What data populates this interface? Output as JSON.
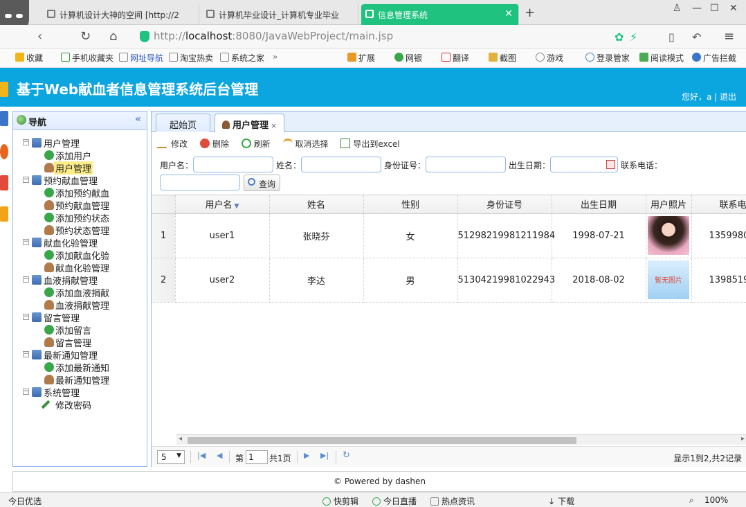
{
  "browser": {
    "tabs": [
      {
        "label": "计算机设计大神的空间 [http://2",
        "active": false
      },
      {
        "label": "计算机毕业设计_计算机专业毕业",
        "active": false
      },
      {
        "label": "信息管理系统",
        "active": true
      }
    ],
    "url_prefix": "http://",
    "url_host": "localhost",
    "url_rest": ":8080/JavaWebProject/main.jsp",
    "bookmarks": [
      "收藏",
      "手机收藏夹",
      "网址导航",
      "淘宝热卖",
      "系统之家",
      "扩展",
      "网银",
      "翻译",
      "截图",
      "游戏",
      "登录管家",
      "阅读模式",
      "广告拦截"
    ],
    "status": {
      "left": "今日优选",
      "items": [
        "快剪辑",
        "今日直播",
        "热点资讯",
        "下载"
      ],
      "zoom": "100%"
    }
  },
  "app": {
    "title": "基于Web献血者信息管理系统后台管理",
    "greeting": "您好，a | 退出",
    "footer": "© Powered by dashen"
  },
  "sidebar": {
    "title": "导航",
    "groups": [
      {
        "label": "用户管理",
        "items": [
          {
            "label": "添加用户",
            "icon": "add-icon"
          },
          {
            "label": "用户管理",
            "icon": "user-icon",
            "selected": true
          }
        ]
      },
      {
        "label": "预约献血管理",
        "items": [
          {
            "label": "添加预约献血",
            "icon": "add-icon"
          },
          {
            "label": "预约献血管理",
            "icon": "user-icon"
          },
          {
            "label": "添加预约状态",
            "icon": "add-icon"
          },
          {
            "label": "预约状态管理",
            "icon": "user-icon"
          }
        ]
      },
      {
        "label": "献血化验管理",
        "items": [
          {
            "label": "添加献血化验",
            "icon": "add-icon"
          },
          {
            "label": "献血化验管理",
            "icon": "user-icon"
          }
        ]
      },
      {
        "label": "血液捐献管理",
        "items": [
          {
            "label": "添加血液捐献",
            "icon": "add-icon"
          },
          {
            "label": "血液捐献管理",
            "icon": "user-icon"
          }
        ]
      },
      {
        "label": "留言管理",
        "items": [
          {
            "label": "添加留言",
            "icon": "add-icon"
          },
          {
            "label": "留言管理",
            "icon": "user-icon"
          }
        ]
      },
      {
        "label": "最新通知管理",
        "items": [
          {
            "label": "添加最新通知",
            "icon": "add-icon"
          },
          {
            "label": "最新通知管理",
            "icon": "user-icon"
          }
        ]
      },
      {
        "label": "系统管理",
        "items": [
          {
            "label": "修改密码",
            "icon": "pencil-icon"
          }
        ]
      }
    ]
  },
  "main": {
    "tabs": [
      {
        "label": "起始页"
      },
      {
        "label": "用户管理",
        "closable": "×"
      }
    ],
    "toolbar": {
      "edit": "修改",
      "delete": "删除",
      "refresh": "刷新",
      "unselect": "取消选择",
      "export": "导出到excel"
    },
    "search": {
      "username_label": "用户名：",
      "name_label": "姓名：",
      "idcard_label": "身份证号：",
      "birthday_label": "出生日期：",
      "phone_label": "联系电话：",
      "button": "查询"
    },
    "grid": {
      "columns": [
        "用户名",
        "姓名",
        "性别",
        "身份证号",
        "出生日期",
        "用户照片",
        "联系电"
      ],
      "rows": [
        {
          "num": "1",
          "username": "user1",
          "name": "张晓芬",
          "gender": "女",
          "idcard": "51298219981211984",
          "birthday": "1998-07-21",
          "photo": "girl-photo",
          "phone": "1359980"
        },
        {
          "num": "2",
          "username": "user2",
          "name": "李达",
          "gender": "男",
          "idcard": "51304219981022943",
          "birthday": "2018-08-02",
          "photo": "暂无图片",
          "phone": "1398519"
        }
      ]
    },
    "pager": {
      "page_size": "5",
      "page_prefix": "第",
      "page_value": "1",
      "page_suffix": "共1页",
      "info": "显示1到2,共2记录"
    }
  }
}
